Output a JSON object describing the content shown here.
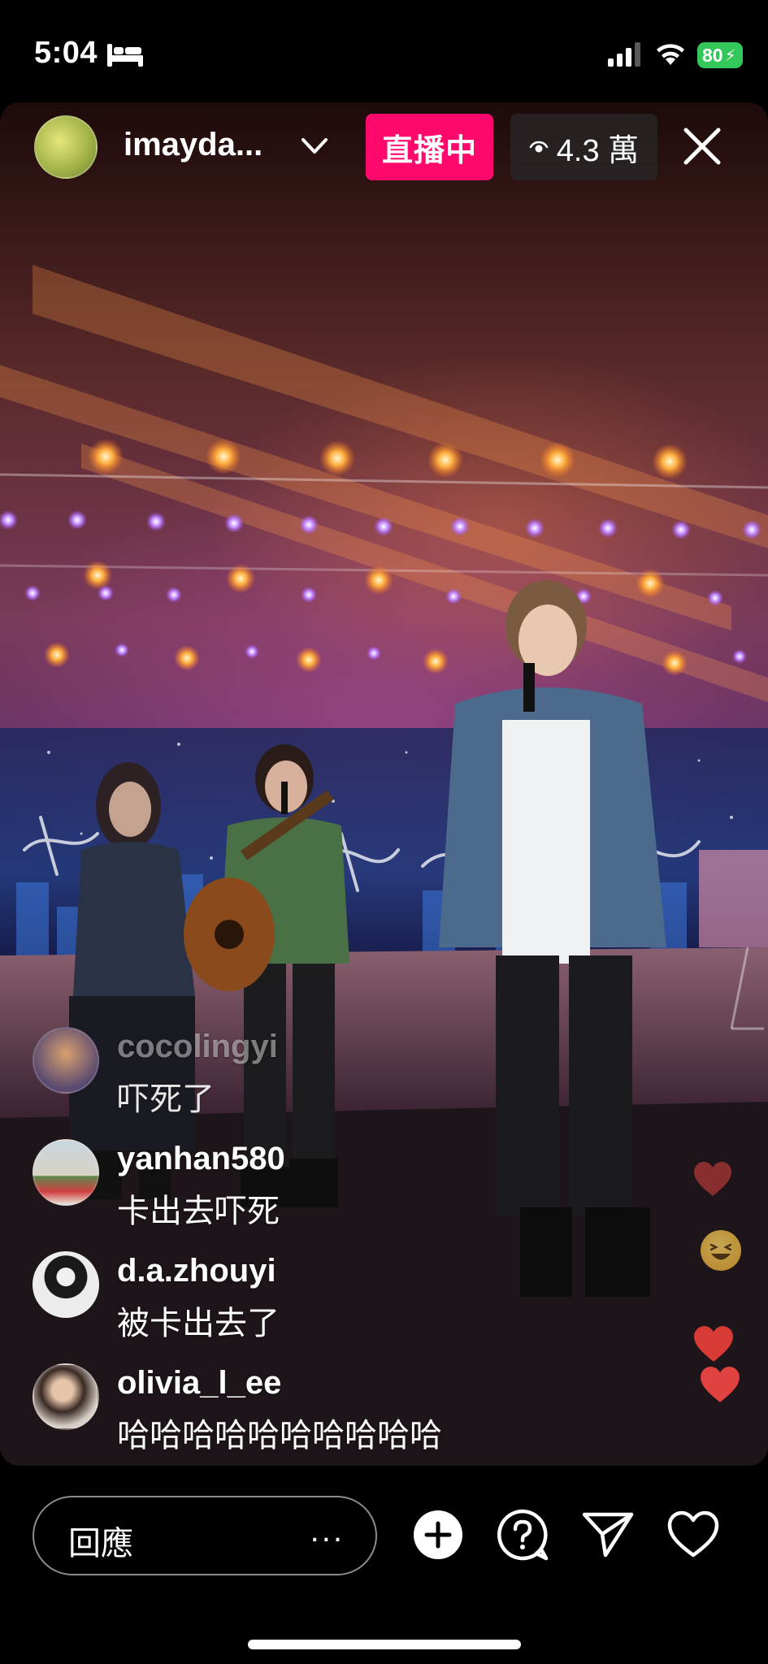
{
  "status_bar": {
    "time": "5:04",
    "battery": "80",
    "icons": [
      "bed-icon",
      "signal-icon",
      "wifi-icon",
      "battery-charging-icon"
    ]
  },
  "header": {
    "host_name": "imayda...",
    "live_label": "直播中",
    "viewer_count": "4.3 萬",
    "icons": [
      "chevron-down-icon",
      "eye-icon",
      "close-icon"
    ]
  },
  "comments": [
    {
      "user": "cocolingyi",
      "text": "吓死了"
    },
    {
      "user": "yanhan580",
      "text": "卡出去吓死"
    },
    {
      "user": "d.a.zhouyi",
      "text": "被卡出去了"
    },
    {
      "user": "olivia_l_ee",
      "text": "哈哈哈哈哈哈哈哈哈哈"
    }
  ],
  "reactions": [
    "heart-icon",
    "laughing-emoji-icon",
    "heart-icon",
    "heart-icon"
  ],
  "bottom_bar": {
    "reply_placeholder": "回應",
    "more_label": "...",
    "icons": [
      "add-icon",
      "question-icon",
      "send-icon",
      "heart-icon"
    ]
  },
  "colors": {
    "live_badge": "#ff0a6c",
    "battery": "#34c759",
    "reaction_heart": "#e0433f"
  }
}
